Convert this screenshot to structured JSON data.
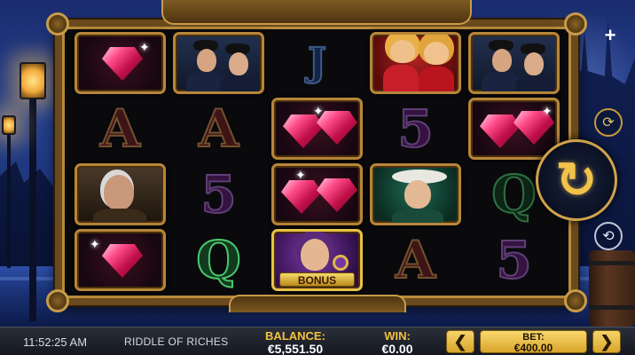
{
  "game": {
    "title": "RIDDLE OF RICHES",
    "clock": "11:52:25 AM"
  },
  "reels": {
    "symbols": [
      [
        "ruby",
        "gentlemen",
        "J",
        "showgirls",
        "gentlemen"
      ],
      [
        "A",
        "A",
        "ruby",
        "5",
        "ruby"
      ],
      [
        "old-man",
        "5",
        "ruby",
        "lady-detective",
        "Q"
      ],
      [
        "ruby",
        "Q",
        "bonus",
        "A",
        "5"
      ]
    ],
    "letters": {
      "A": "A",
      "five": "5",
      "Q": "Q",
      "J": "J"
    },
    "bonus_label": "BONUS"
  },
  "controls": {
    "add_symbol": "+",
    "turbo_symbol": "⟳",
    "spin_symbol": "↻",
    "autoplay_symbol": "⟲"
  },
  "status_bar": {
    "balance_label": "BALANCE:",
    "balance_value": "€5,551.50",
    "win_label": "WIN:",
    "win_value": "€0.00",
    "bet_label": "BET:",
    "bet_value": "€400.00",
    "prev_symbol": "❮",
    "next_symbol": "❯"
  },
  "colors": {
    "accent_gold": "#f3c23d",
    "frame_bronze": "#b7863a"
  }
}
